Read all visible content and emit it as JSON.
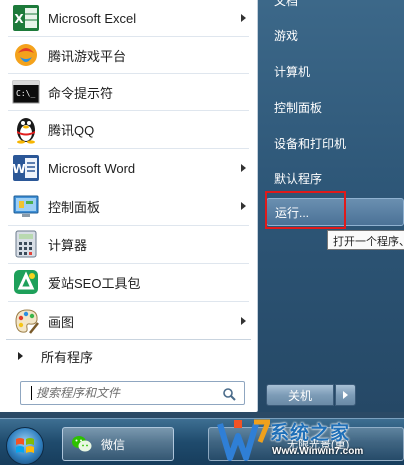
{
  "start_menu": {
    "pinned_programs": [
      {
        "label": "Microsoft Excel",
        "icon": "excel-icon",
        "has_submenu": true
      },
      {
        "label": "腾讯游戏平台",
        "icon": "tencent-game-icon",
        "has_submenu": false
      },
      {
        "label": "命令提示符",
        "icon": "command-prompt-icon",
        "has_submenu": false
      },
      {
        "label": "腾讯QQ",
        "icon": "qq-penguin-icon",
        "has_submenu": false
      },
      {
        "label": "Microsoft Word",
        "icon": "word-icon",
        "has_submenu": true
      },
      {
        "label": "控制面板",
        "icon": "control-panel-icon",
        "has_submenu": true
      },
      {
        "label": "计算器",
        "icon": "calculator-icon",
        "has_submenu": false
      },
      {
        "label": "爱站SEO工具包",
        "icon": "aizhan-seo-icon",
        "has_submenu": false
      },
      {
        "label": "画图",
        "icon": "paint-icon",
        "has_submenu": true
      }
    ],
    "all_programs_label": "所有程序",
    "search": {
      "placeholder": "搜索程序和文件",
      "value": ""
    },
    "right_items": [
      {
        "label": "文档"
      },
      {
        "label": "游戏"
      },
      {
        "label": "计算机"
      },
      {
        "label": "控制面板"
      },
      {
        "label": "设备和打印机"
      },
      {
        "label": "默认程序"
      },
      {
        "label": "运行..."
      }
    ],
    "run_tooltip": "打开一个程序、",
    "shutdown_label": "关机"
  },
  "taskbar": {
    "items": [
      {
        "label": "微信",
        "icon": "wechat-icon"
      },
      {
        "label": "无限光景(重)"
      }
    ]
  },
  "watermark": {
    "brand": "系统之家",
    "url": "Www.Winwin7.com"
  },
  "colors": {
    "highlight": "#e01a1a",
    "right_pane": "#2e5778",
    "taskbar": "#1f4b6d",
    "watermark_blue": "#1e6fb8"
  }
}
